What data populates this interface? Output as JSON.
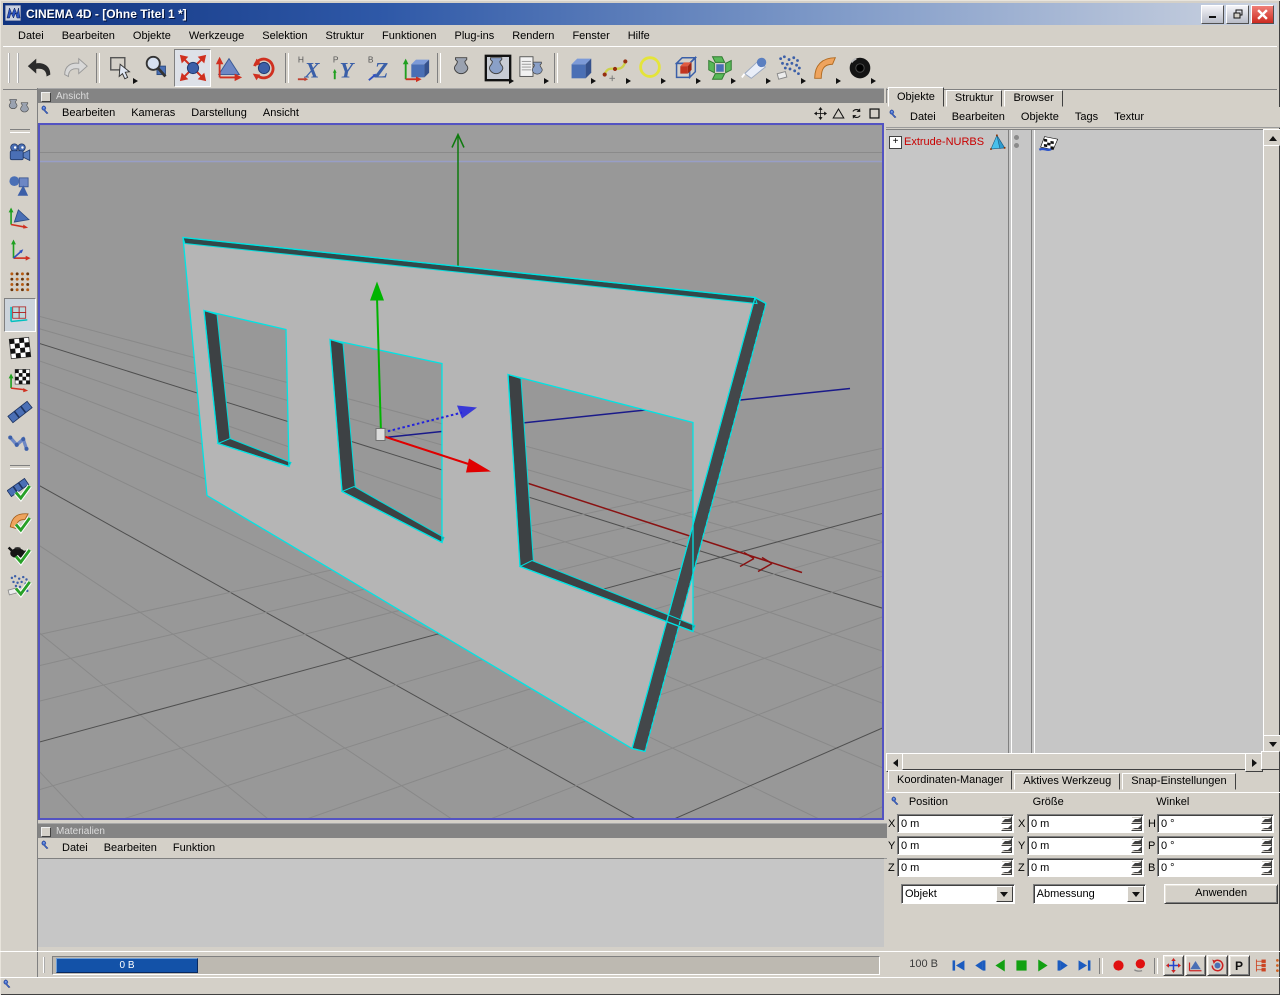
{
  "window": {
    "title": "CINEMA 4D - [Ohne Titel 1 *]",
    "controls": [
      "minimize",
      "restore",
      "close"
    ]
  },
  "menu_bar": [
    "Datei",
    "Bearbeiten",
    "Objekte",
    "Werkzeuge",
    "Selektion",
    "Struktur",
    "Funktionen",
    "Plug-ins",
    "Rendern",
    "Fenster",
    "Hilfe"
  ],
  "toolbar": [
    {
      "name": "undo-button",
      "icon": "undo"
    },
    {
      "name": "redo-button",
      "icon": "redo"
    },
    {
      "sep": true
    },
    {
      "name": "selection-tool-button",
      "icon": "select",
      "flyout": true
    },
    {
      "name": "zoom-tool-button",
      "icon": "magnify"
    },
    {
      "name": "move-tool-button",
      "icon": "move",
      "active": true
    },
    {
      "name": "scale-tool-button",
      "icon": "scale"
    },
    {
      "name": "rotate-tool-button",
      "icon": "rotate"
    },
    {
      "sep": true
    },
    {
      "name": "lock-x-axis-button",
      "icon": "lockx"
    },
    {
      "name": "lock-y-axis-button",
      "icon": "locky"
    },
    {
      "name": "lock-z-axis-button",
      "icon": "lockz"
    },
    {
      "name": "coordinate-system-button",
      "icon": "worldcube"
    },
    {
      "sep": true
    },
    {
      "name": "render-view-button",
      "icon": "renderview"
    },
    {
      "name": "render-active-view-button",
      "icon": "renderframe",
      "flyout": true
    },
    {
      "name": "render-settings-button",
      "icon": "rendersettings",
      "flyout": true
    },
    {
      "sep": true
    },
    {
      "name": "add-primitive-button",
      "icon": "cube",
      "flyout": true
    },
    {
      "name": "add-spline-button",
      "icon": "spline",
      "flyout": true
    },
    {
      "name": "add-spline-primitive-button",
      "icon": "circlespline",
      "flyout": true
    },
    {
      "name": "add-nurbs-button",
      "icon": "nurbs",
      "flyout": true
    },
    {
      "name": "add-modeling-object-button",
      "icon": "modeling",
      "flyout": true
    },
    {
      "name": "add-scene-object-button",
      "icon": "light",
      "flyout": true
    },
    {
      "name": "add-particle-system-button",
      "icon": "particles",
      "flyout": true
    },
    {
      "name": "add-deformer-button",
      "icon": "bend",
      "flyout": true
    },
    {
      "name": "add-sound-button",
      "icon": "sound",
      "flyout": true
    }
  ],
  "sidebar": [
    {
      "name": "material-tools-button",
      "icon": "vases2"
    },
    {
      "sep": true
    },
    {
      "name": "camera-mode-button",
      "icon": "cameramode"
    },
    {
      "name": "object-mode-button",
      "icon": "objectmode"
    },
    {
      "name": "object-axis-mode-button",
      "icon": "objaxismode"
    },
    {
      "name": "axis-mode-button",
      "icon": "axismode"
    },
    {
      "name": "points-mode-button",
      "icon": "pointsmode"
    },
    {
      "name": "polygons-mode-button",
      "icon": "polymode",
      "active": true
    },
    {
      "name": "texture-mode-button",
      "icon": "texturemode"
    },
    {
      "name": "texture-axis-mode-button",
      "icon": "texaxismode"
    },
    {
      "name": "edges-mode-button",
      "icon": "edgemode"
    },
    {
      "name": "kinematics-mode-button",
      "icon": "ikmode"
    },
    {
      "sep": true
    },
    {
      "name": "animation-toggle",
      "icon": "animtoggle"
    },
    {
      "name": "deformers-toggle",
      "icon": "deformtoggle"
    },
    {
      "name": "generators-toggle",
      "icon": "rendertoggle"
    },
    {
      "name": "particles-toggle",
      "icon": "parttoggle"
    }
  ],
  "viewport": {
    "title": "Ansicht",
    "menu": [
      "Bearbeiten",
      "Kameras",
      "Darstellung",
      "Ansicht"
    ],
    "view_controls": [
      {
        "name": "pan-view-button",
        "icon": "panview"
      },
      {
        "name": "scale-view-button",
        "icon": "scaleview"
      },
      {
        "name": "rotate-view-button",
        "icon": "rotateview"
      },
      {
        "name": "toggle-maximize-view-button",
        "icon": "maxview"
      }
    ]
  },
  "object_manager": {
    "tabs": [
      "Objekte",
      "Struktur",
      "Browser"
    ],
    "active_tab": "Objekte",
    "menu": [
      "Datei",
      "Bearbeiten",
      "Objekte",
      "Tags",
      "Textur"
    ],
    "objects": [
      {
        "label": "Extrude-NURBS",
        "expander": "+",
        "selected": true,
        "type_icon": "extrude-nurbs-icon",
        "tag_icon": "render-flag-icon"
      }
    ]
  },
  "coordinate_manager": {
    "tabs": [
      "Koordinaten-Manager",
      "Aktives Werkzeug",
      "Snap-Einstellungen"
    ],
    "active_tab": "Koordinaten-Manager",
    "groups": [
      {
        "key": "position",
        "header": "Position",
        "rows": [
          [
            "X",
            "0 m"
          ],
          [
            "Y",
            "0 m"
          ],
          [
            "Z",
            "0 m"
          ]
        ]
      },
      {
        "key": "groesse",
        "header": "Größe",
        "rows": [
          [
            "X",
            "0 m"
          ],
          [
            "Y",
            "0 m"
          ],
          [
            "Z",
            "0 m"
          ]
        ]
      },
      {
        "key": "winkel",
        "header": "Winkel",
        "rows": [
          [
            "H",
            "0 °"
          ],
          [
            "P",
            "0 °"
          ],
          [
            "B",
            "0 °"
          ]
        ]
      }
    ],
    "system_value": "Objekt",
    "dimension_value": "Abmessung",
    "apply_label": "Anwenden"
  },
  "materials": {
    "title": "Materialien",
    "menu": [
      "Datei",
      "Bearbeiten",
      "Funktion"
    ]
  },
  "timeline": {
    "current_label": "0 B",
    "end_label": "100 B"
  },
  "transport": [
    {
      "name": "goto-start-button",
      "icon": "tstart"
    },
    {
      "name": "previous-frame-button",
      "icon": "tprev"
    },
    {
      "name": "play-backwards-button",
      "icon": "tplayback"
    },
    {
      "name": "stop-button",
      "icon": "tstop"
    },
    {
      "name": "play-forwards-button",
      "icon": "tplay"
    },
    {
      "name": "next-frame-button",
      "icon": "tnext"
    },
    {
      "name": "goto-end-button",
      "icon": "tend"
    },
    {
      "sep": true
    },
    {
      "name": "record-button",
      "icon": "rec"
    },
    {
      "name": "record-objects-button",
      "icon": "rec2"
    },
    {
      "sep": true
    },
    {
      "name": "key-position-button",
      "icon": "keypos",
      "raised": true
    },
    {
      "name": "key-scale-button",
      "icon": "keyscale",
      "raised": true
    },
    {
      "name": "key-rotation-button",
      "icon": "keyrot",
      "raised": true
    },
    {
      "name": "key-parameter-button",
      "icon": "keyparam",
      "raised": true
    },
    {
      "name": "hierarchy-button",
      "icon": "hier"
    },
    {
      "name": "point-level-animation-button",
      "icon": "dotsgrid"
    },
    {
      "name": "layout-button",
      "icon": "pagearrow"
    }
  ],
  "scene": {
    "selected_object": "Extrude-NURBS",
    "description": "extruded wall with three rectangular window openings on perspective ground grid"
  },
  "colors": {
    "selection_outline": "#00e4e4",
    "selected_object_text": "#c80000",
    "viewport_background": "#989898",
    "object_fill": "#b5b5b5",
    "timeline_thumb": "#1352a8",
    "viewport_border": "#5353c2",
    "axis_x": "#e00000",
    "axis_y": "#00b400",
    "axis_z": "#2222dd"
  }
}
